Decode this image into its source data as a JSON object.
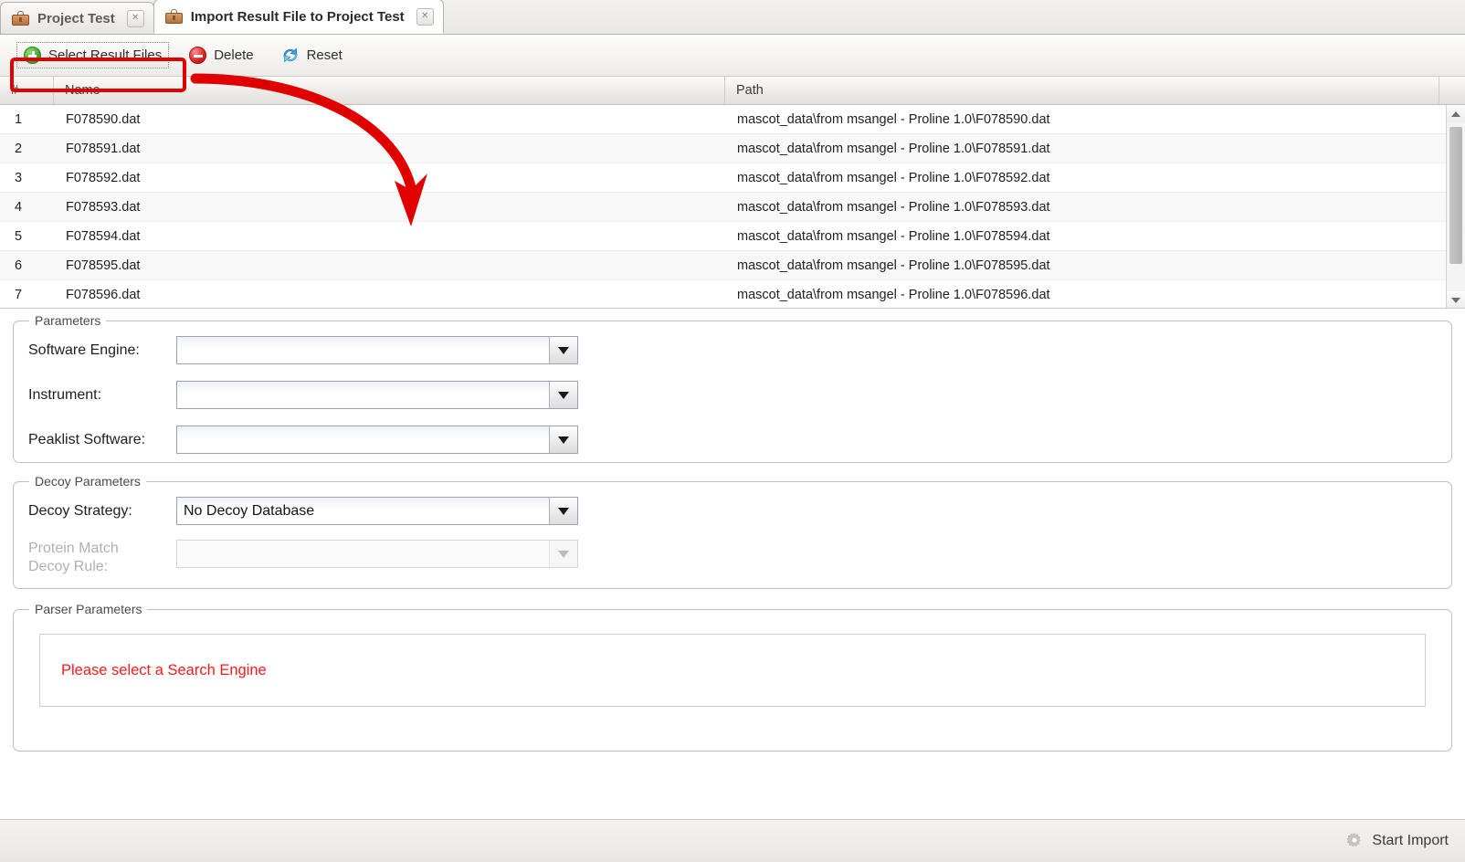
{
  "window": {
    "title": "Import Result File to Project Test"
  },
  "tabs": [
    {
      "label": "Project Test",
      "icon": "briefcase-icon",
      "close": "✕",
      "active": false
    },
    {
      "label": "Import Result File to Project Test",
      "icon": "briefcase-icon",
      "close": "✕",
      "active": true
    }
  ],
  "toolbar": {
    "select_files_label": "Select Result Files",
    "delete_label": "Delete",
    "reset_label": "Reset"
  },
  "table": {
    "columns": [
      "#",
      "Name",
      "Path"
    ],
    "rows": [
      {
        "num": "1",
        "name": "F078590.dat",
        "path": "mascot_data\\from msangel - Proline 1.0\\F078590.dat"
      },
      {
        "num": "2",
        "name": "F078591.dat",
        "path": "mascot_data\\from msangel - Proline 1.0\\F078591.dat"
      },
      {
        "num": "3",
        "name": "F078592.dat",
        "path": "mascot_data\\from msangel - Proline 1.0\\F078592.dat"
      },
      {
        "num": "4",
        "name": "F078593.dat",
        "path": "mascot_data\\from msangel - Proline 1.0\\F078593.dat"
      },
      {
        "num": "5",
        "name": "F078594.dat",
        "path": "mascot_data\\from msangel - Proline 1.0\\F078594.dat"
      },
      {
        "num": "6",
        "name": "F078595.dat",
        "path": "mascot_data\\from msangel - Proline 1.0\\F078595.dat"
      },
      {
        "num": "7",
        "name": "F078596.dat",
        "path": "mascot_data\\from msangel - Proline 1.0\\F078596.dat"
      }
    ]
  },
  "parameters": {
    "legend": "Parameters",
    "software_engine": {
      "label": "Software Engine:",
      "value": ""
    },
    "instrument": {
      "label": "Instrument:",
      "value": ""
    },
    "peaklist_software": {
      "label": "Peaklist Software:",
      "value": ""
    }
  },
  "decoy": {
    "legend": "Decoy Parameters",
    "strategy": {
      "label": "Decoy Strategy:",
      "value": "No Decoy Database"
    },
    "protein_match_rule": {
      "label_line1": "Protein Match",
      "label_line2": "Decoy Rule:",
      "value": ""
    }
  },
  "parser": {
    "legend": "Parser Parameters",
    "message": "Please select a Search Engine"
  },
  "statusbar": {
    "start_import_label": "Start Import"
  },
  "colors": {
    "annotation_red": "#e00000",
    "error_red": "#ff1a1a",
    "panel_border": "#b9bdd1"
  }
}
